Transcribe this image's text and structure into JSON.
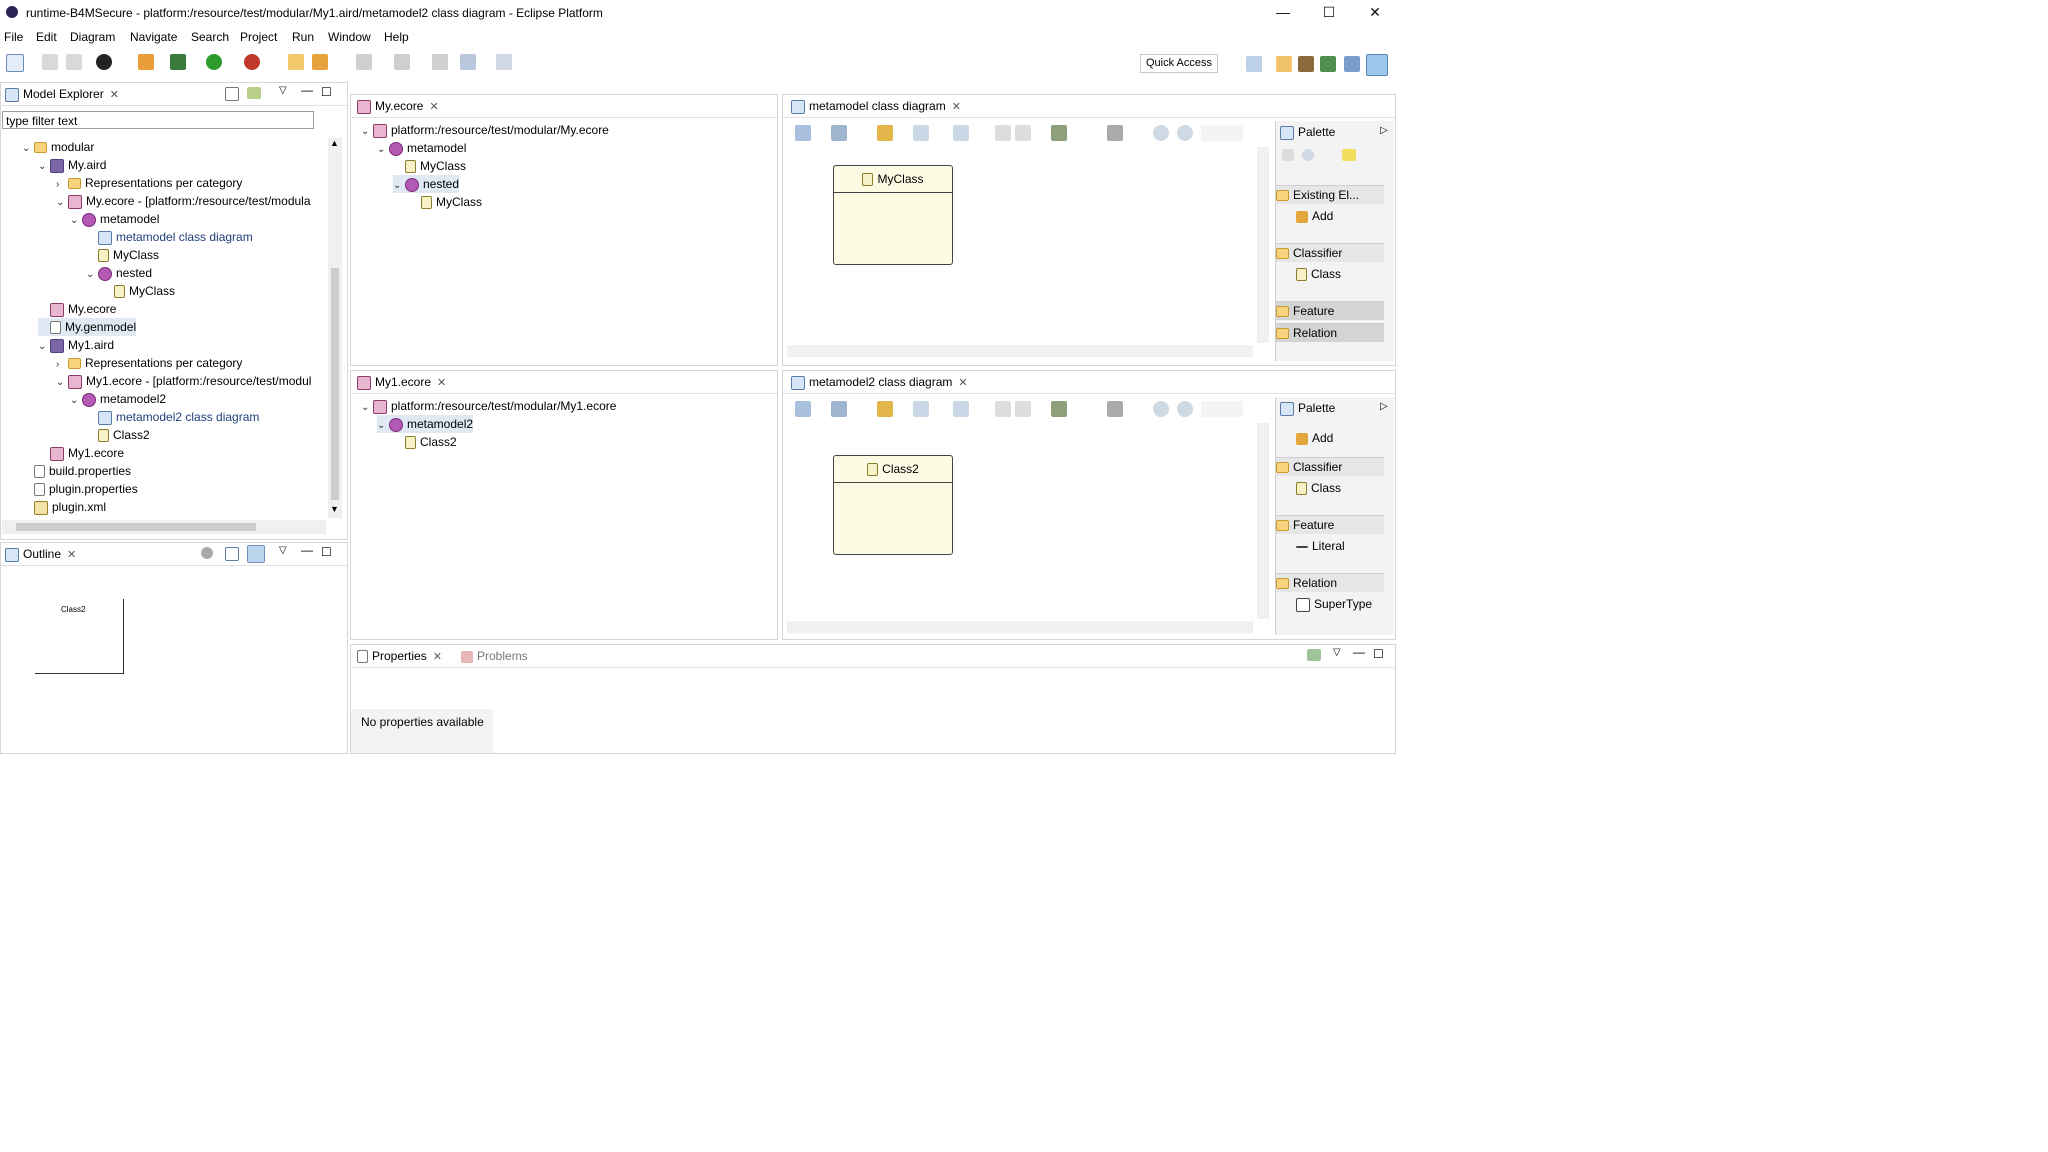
{
  "window": {
    "title": "runtime-B4MSecure - platform:/resource/test/modular/My1.aird/metamodel2 class diagram - Eclipse Platform",
    "minimize": "—",
    "maximize": "☐",
    "close": "✕"
  },
  "menu": [
    "File",
    "Edit",
    "Diagram",
    "Navigate",
    "Search",
    "Project",
    "Run",
    "Window",
    "Help"
  ],
  "quick_access": "Quick Access",
  "model_explorer": {
    "tab": "Model Explorer",
    "filter_placeholder": "type filter text",
    "rows": [
      {
        "label": "modular",
        "icon": "folder-icon",
        "exp": "⌄"
      },
      {
        "label": "My.aird",
        "icon": "aird-icon",
        "exp": "⌄"
      },
      {
        "label": "Representations per category",
        "icon": "folder-icon",
        "exp": "›"
      },
      {
        "label": "My.ecore - [platform:/resource/test/modula",
        "icon": "ecore-icon",
        "exp": "⌄"
      },
      {
        "label": "metamodel",
        "icon": "package-icon",
        "exp": "⌄"
      },
      {
        "label": "metamodel class diagram",
        "icon": "diagram-icon",
        "exp": ""
      },
      {
        "label": "MyClass",
        "icon": "class-icon",
        "exp": ""
      },
      {
        "label": "nested",
        "icon": "package-icon",
        "exp": "⌄"
      },
      {
        "label": "MyClass",
        "icon": "class-icon",
        "exp": ""
      },
      {
        "label": "My.ecore",
        "icon": "ecore-icon",
        "exp": ""
      },
      {
        "label": "My.genmodel",
        "icon": "file-icon",
        "exp": ""
      },
      {
        "label": "My1.aird",
        "icon": "aird-icon",
        "exp": "⌄"
      },
      {
        "label": "Representations per category",
        "icon": "folder-icon",
        "exp": "›"
      },
      {
        "label": "My1.ecore - [platform:/resource/test/modul",
        "icon": "ecore-icon",
        "exp": "⌄"
      },
      {
        "label": "metamodel2",
        "icon": "package-icon",
        "exp": "⌄"
      },
      {
        "label": "metamodel2 class diagram",
        "icon": "diagram-icon",
        "exp": ""
      },
      {
        "label": "Class2",
        "icon": "class-icon",
        "exp": ""
      },
      {
        "label": "My1.ecore",
        "icon": "ecore-icon",
        "exp": ""
      },
      {
        "label": "build.properties",
        "icon": "file-icon",
        "exp": ""
      },
      {
        "label": "plugin.properties",
        "icon": "file-icon",
        "exp": ""
      },
      {
        "label": "plugin.xml",
        "icon": "xml-icon",
        "exp": ""
      }
    ]
  },
  "outline": {
    "tab": "Outline",
    "thumb_label": "Class2"
  },
  "editor_my_ecore": {
    "tab": "My.ecore",
    "rows": [
      {
        "label": "platform:/resource/test/modular/My.ecore",
        "icon": "ecore-icon",
        "exp": "⌄"
      },
      {
        "label": "metamodel",
        "icon": "package-icon",
        "exp": "⌄"
      },
      {
        "label": "MyClass",
        "icon": "class-icon",
        "exp": ""
      },
      {
        "label": "nested",
        "icon": "package-icon",
        "exp": "⌄"
      },
      {
        "label": "MyClass",
        "icon": "class-icon",
        "exp": ""
      }
    ]
  },
  "editor_my1_ecore": {
    "tab": "My1.ecore",
    "rows": [
      {
        "label": "platform:/resource/test/modular/My1.ecore",
        "icon": "ecore-icon",
        "exp": "⌄"
      },
      {
        "label": "metamodel2",
        "icon": "package-icon",
        "exp": "⌄"
      },
      {
        "label": "Class2",
        "icon": "class-icon",
        "exp": ""
      }
    ]
  },
  "diagram1": {
    "tab": "metamodel class diagram",
    "class_name": "MyClass",
    "palette": {
      "title": "Palette",
      "drawers": [
        "Existing El...",
        "Classifier",
        "Feature",
        "Relation"
      ],
      "items": [
        "Add",
        "Class"
      ]
    }
  },
  "diagram2": {
    "tab": "metamodel2 class diagram",
    "class_name": "Class2",
    "palette": {
      "title": "Palette",
      "drawers": [
        "Classifier",
        "Feature",
        "Relation"
      ],
      "items": [
        "Add",
        "Class",
        "Literal",
        "SuperType"
      ]
    }
  },
  "bottom": {
    "tab_properties": "Properties",
    "tab_problems": "Problems",
    "no_properties": "No properties available"
  }
}
